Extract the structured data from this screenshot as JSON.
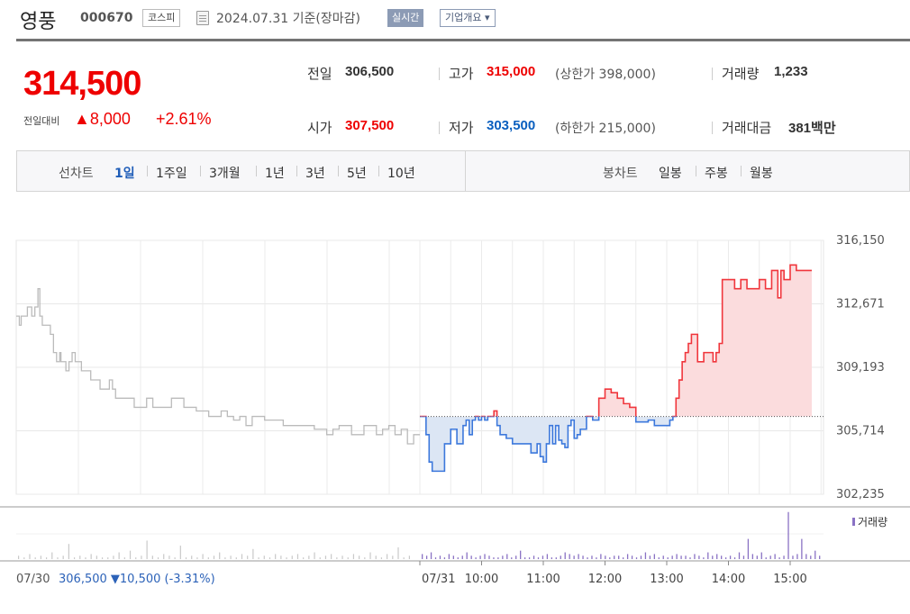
{
  "header": {
    "stock_name": "영풍",
    "stock_code": "000670",
    "market": "코스피",
    "date_text": "2024.07.31 기준(장마감)",
    "realtime_label": "실시간",
    "company_overview_label": "기업개요 ▾"
  },
  "quote": {
    "current_price": "314,500",
    "change_label": "전일대비",
    "change_value": "▲8,000",
    "change_rate": "+2.61%",
    "prev_close_label": "전일",
    "prev_close": "306,500",
    "open_label": "시가",
    "open": "307,500",
    "high_label": "고가",
    "high": "315,000",
    "upper_limit": "(상한가 398,000)",
    "low_label": "저가",
    "low": "303,500",
    "lower_limit": "(하한가 215,000)",
    "volume_label": "거래량",
    "volume": "1,233",
    "value_label": "거래대금",
    "value": "381백만"
  },
  "period_bar": {
    "line_chart_label": "선차트",
    "periods": [
      "1일",
      "1주일",
      "3개월",
      "1년",
      "3년",
      "5년",
      "10년"
    ],
    "active_period": "1일",
    "candle_chart_label": "봉차트",
    "candle_periods": [
      "일봉",
      "주봉",
      "월봉"
    ]
  },
  "colors": {
    "up": "#e00000",
    "down": "#0a5fbf",
    "line_up": "#f0363c",
    "line_down": "#3c78dc",
    "fill_up": "#fbdcdd",
    "fill_down": "#dce6f4",
    "prev_day_line": "#bbbbbb",
    "volume_bar": "#8a72c4"
  },
  "chart_data": {
    "type": "line",
    "title": "",
    "ylim": [
      302235,
      316150
    ],
    "y_ticks": [
      "316,150",
      "312,671",
      "309,193",
      "305,714",
      "302,235"
    ],
    "baseline": 306500,
    "x_tick_labels": [
      "07/31",
      "10:00",
      "11:00",
      "12:00",
      "13:00",
      "14:00",
      "15:00"
    ],
    "volume_legend": "거래량",
    "prev_day_label": "07/30",
    "prev_day_summary": "306,500 ▼10,500 (-3.31%)",
    "prev_day_series": {
      "x": [
        0.0,
        0.05,
        0.08,
        0.12,
        0.18,
        0.25,
        0.3,
        0.35,
        0.38,
        0.42,
        0.5,
        0.55,
        0.6,
        0.65,
        0.7,
        0.72,
        0.75,
        0.8,
        0.85,
        0.9,
        0.95,
        1.0,
        1.05,
        1.1,
        1.2,
        1.3,
        1.35,
        1.4,
        1.45,
        1.5,
        1.55,
        1.6,
        1.7,
        1.8,
        1.9,
        2.0,
        2.1,
        2.2,
        2.3,
        2.4,
        2.5,
        2.6,
        2.7,
        2.8,
        2.9,
        3.0,
        3.1,
        3.2,
        3.3,
        3.4,
        3.5,
        3.6,
        3.7,
        3.8,
        3.9,
        4.0,
        4.1,
        4.2,
        4.3,
        4.4,
        4.5,
        4.6,
        4.7,
        4.8,
        4.9,
        5.0,
        5.1,
        5.2,
        5.3,
        5.4,
        5.5,
        5.6,
        5.7,
        5.8,
        5.9,
        6.0,
        6.1,
        6.2,
        6.3,
        6.4,
        6.5
      ],
      "y": [
        312000,
        311500,
        312000,
        312000,
        312500,
        312000,
        312500,
        313500,
        312000,
        311500,
        311500,
        311000,
        310000,
        309500,
        310000,
        309500,
        309500,
        309000,
        309500,
        310000,
        309500,
        309500,
        309000,
        309000,
        308500,
        308500,
        308000,
        308000,
        308000,
        308500,
        308000,
        307500,
        307500,
        307500,
        307000,
        307000,
        307500,
        307000,
        307000,
        307000,
        307500,
        307500,
        307000,
        307000,
        306800,
        306800,
        306500,
        306500,
        306800,
        306500,
        306300,
        306500,
        306000,
        306500,
        306500,
        306300,
        306300,
        306300,
        306000,
        306000,
        306000,
        306000,
        306000,
        305800,
        305800,
        305500,
        305800,
        306000,
        306000,
        305500,
        305500,
        306000,
        306000,
        305500,
        305800,
        306000,
        305500,
        305800,
        305000,
        305500,
        305500
      ]
    },
    "today_series": {
      "x": [
        9.0,
        9.1,
        9.15,
        9.2,
        9.3,
        9.4,
        9.5,
        9.6,
        9.7,
        9.75,
        9.8,
        9.85,
        9.9,
        9.95,
        10.0,
        10.05,
        10.1,
        10.15,
        10.2,
        10.25,
        10.3,
        10.35,
        10.4,
        10.45,
        10.5,
        10.55,
        10.6,
        10.7,
        10.8,
        10.9,
        10.95,
        11.0,
        11.05,
        11.1,
        11.15,
        11.2,
        11.25,
        11.3,
        11.35,
        11.4,
        11.45,
        11.5,
        11.55,
        11.6,
        11.7,
        11.8,
        11.9,
        12.0,
        12.1,
        12.2,
        12.3,
        12.4,
        12.5,
        12.6,
        12.7,
        12.8,
        12.9,
        13.0,
        13.05,
        13.1,
        13.15,
        13.2,
        13.25,
        13.3,
        13.35,
        13.4,
        13.5,
        13.6,
        13.7,
        13.75,
        13.8,
        13.85,
        13.9,
        14.0,
        14.1,
        14.2,
        14.3,
        14.4,
        14.5,
        14.6,
        14.7,
        14.8,
        14.85,
        14.9,
        14.95,
        15.0,
        15.1,
        15.2,
        15.3
      ],
      "y": [
        306500,
        305500,
        304000,
        303500,
        303500,
        305000,
        305800,
        305000,
        306000,
        306300,
        305500,
        306300,
        306500,
        306300,
        306500,
        306300,
        306500,
        306500,
        306800,
        306000,
        305500,
        305500,
        305300,
        305300,
        305000,
        305000,
        305000,
        305000,
        304500,
        305000,
        304300,
        304000,
        305000,
        306000,
        305000,
        306000,
        305200,
        305000,
        304800,
        306000,
        306300,
        305300,
        305500,
        305800,
        306500,
        306300,
        307500,
        308000,
        307800,
        307500,
        307200,
        307000,
        306200,
        306200,
        306300,
        306000,
        306000,
        306000,
        306300,
        306500,
        307500,
        308500,
        309500,
        310000,
        310500,
        311000,
        309500,
        310000,
        310000,
        309500,
        310000,
        310500,
        314000,
        314000,
        313500,
        314000,
        313500,
        313500,
        314000,
        313500,
        314500,
        313000,
        314500,
        314000,
        314000,
        314800,
        314500,
        314500,
        314500
      ]
    },
    "prev_day_volume": [
      2,
      1,
      3,
      1,
      2,
      1,
      4,
      1,
      2,
      9,
      1,
      2,
      1,
      3,
      2,
      1,
      1,
      2,
      4,
      1,
      5,
      1,
      2,
      11,
      2,
      1,
      3,
      2,
      1,
      8,
      1,
      2,
      1,
      3,
      1,
      2,
      4,
      1,
      2,
      1,
      3,
      2,
      6,
      1,
      2,
      1,
      3,
      2,
      1,
      2,
      3,
      1,
      2,
      4,
      1,
      2,
      3,
      1,
      2,
      1,
      3,
      2,
      1,
      4,
      2,
      1,
      3,
      2,
      7,
      1,
      2
    ],
    "today_volume": [
      3,
      2,
      4,
      1,
      2,
      1,
      3,
      2,
      1,
      2,
      4,
      2,
      1,
      2,
      3,
      2,
      1,
      1,
      2,
      3,
      1,
      2,
      5,
      1,
      1,
      2,
      1,
      2,
      3,
      1,
      1,
      2,
      4,
      3,
      2,
      3,
      2,
      1,
      2,
      1,
      3,
      2,
      1,
      2,
      2,
      1,
      3,
      2,
      1,
      2,
      4,
      2,
      3,
      1,
      2,
      1,
      2,
      3,
      2,
      2,
      1,
      3,
      2,
      1,
      4,
      2,
      3,
      2,
      1,
      2,
      1,
      4,
      2,
      12,
      3,
      2,
      4,
      1,
      2,
      3,
      1,
      2,
      28,
      2,
      3,
      12,
      3,
      2,
      5,
      2
    ]
  }
}
